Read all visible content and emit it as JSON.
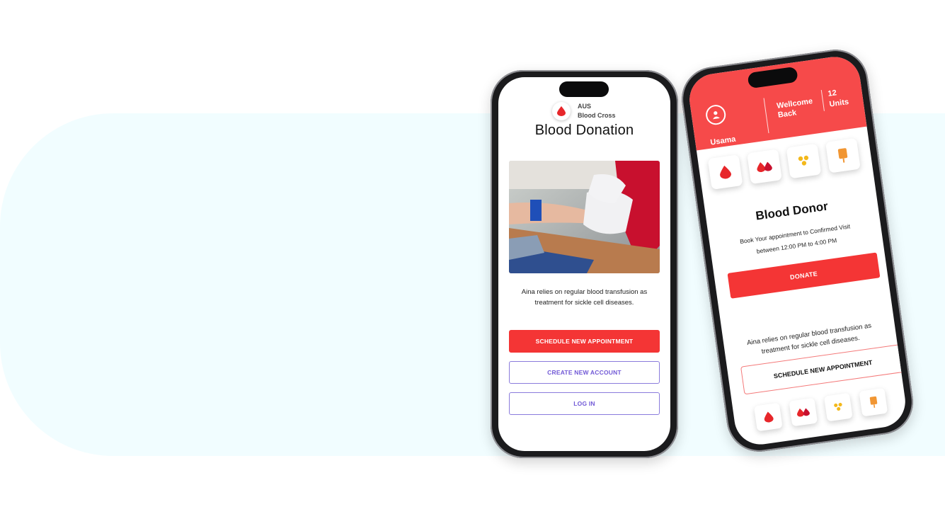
{
  "colors": {
    "accent_red": "#f43535",
    "header_red": "#f64a4a",
    "outline_purple": "#7159d6",
    "band": "#f1fdff",
    "gold": "#f3b81b",
    "orange": "#f19633"
  },
  "phone1": {
    "brand_line1": "AUS",
    "brand_line2": "Blood Cross",
    "title": "Blood Donation",
    "caption": "Aina relies on regular blood transfusion as treatment for sickle cell diseases.",
    "schedule_label": "SCHEDULE NEW APPOINTMENT",
    "create_label": "CREATE NEW ACCOUNT",
    "login_label": "LOG IN"
  },
  "phone2": {
    "username": "Usama",
    "welcome": "Wellcome Back",
    "units_count": "12",
    "units_label": "Units",
    "categories": [
      "blood-drop-icon",
      "double-drop-icon",
      "platelets-icon",
      "plasma-bag-icon"
    ],
    "title": "Blood Donor",
    "subtitle_line1": "Book Your appointment to Confirmed Visit",
    "subtitle_line2": "between 12:00 PM to 4:00 PM",
    "donate_label": "DONATE",
    "caption": "Aina relies on regular blood transfusion as treatment for sickle cell diseases.",
    "schedule_label": "SCHEDULE NEW APPOINTMENT"
  }
}
